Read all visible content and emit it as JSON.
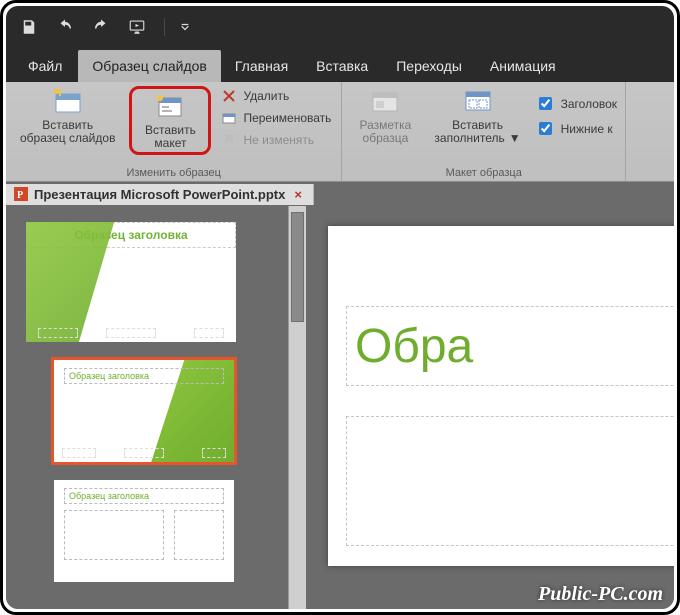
{
  "qat": {
    "save": "save-icon",
    "undo": "undo-icon",
    "redo": "redo-icon",
    "present": "present-from-start-icon"
  },
  "tabs": {
    "file": "Файл",
    "slide_master": "Образец слайдов",
    "home": "Главная",
    "insert": "Вставка",
    "transitions": "Переходы",
    "animations": "Анимация"
  },
  "ribbon": {
    "group_edit_master": {
      "insert_slide_master": {
        "line1": "Вставить",
        "line2": "образец слайдов"
      },
      "insert_layout": {
        "line1": "Вставить",
        "line2": "макет"
      },
      "delete": "Удалить",
      "rename": "Переименовать",
      "preserve": "Не изменять",
      "label": "Изменить образец"
    },
    "group_master_layout": {
      "master_layout": {
        "line1": "Разметка",
        "line2": "образца"
      },
      "insert_placeholder": {
        "line1": "Вставить",
        "line2": "заполнитель"
      },
      "chk_title": "Заголовок",
      "chk_footers": "Нижние к",
      "label": "Макет образца"
    }
  },
  "document": {
    "filename": "Презентация Microsoft PowerPoint.pptx",
    "close_glyph": "×"
  },
  "thumbs": {
    "master_title": "Образец заголовка",
    "layout_title": "Образец заголовка"
  },
  "canvas": {
    "title_placeholder_text": "Обра"
  },
  "watermark": "Public-PC.com"
}
